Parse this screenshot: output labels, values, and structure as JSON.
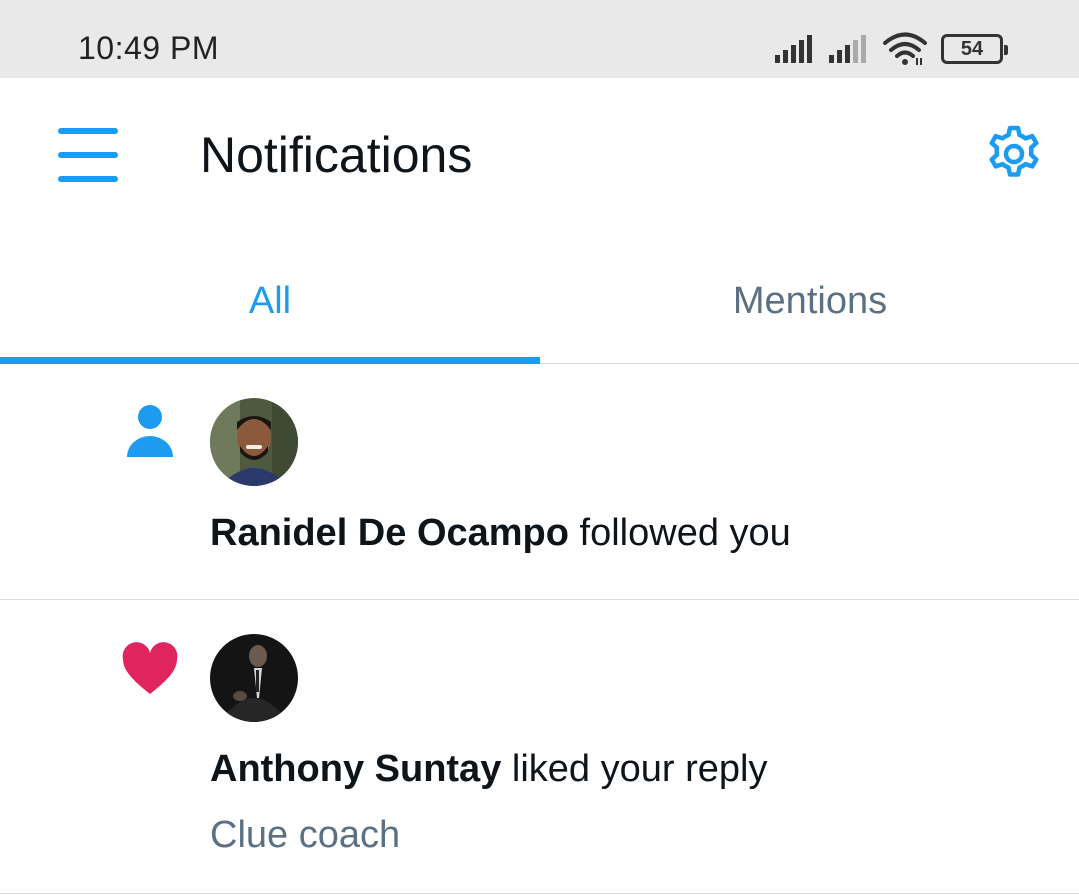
{
  "status_bar": {
    "time": "10:49 PM",
    "battery": "54",
    "icons": [
      "signal-icon",
      "signal-icon",
      "wifi-icon",
      "battery-icon"
    ]
  },
  "header": {
    "title": "Notifications",
    "menu_icon": "hamburger-menu-icon",
    "settings_icon": "gear-icon"
  },
  "tabs": [
    {
      "label": "All",
      "active": true
    },
    {
      "label": "Mentions",
      "active": false
    }
  ],
  "colors": {
    "accent": "#1d9bf0",
    "like": "#e0245e",
    "secondary_text": "#5b7083"
  },
  "notifications": [
    {
      "type_icon": "person-icon",
      "user": "Ranidel De Ocampo",
      "action": "followed you",
      "detail": ""
    },
    {
      "type_icon": "heart-icon",
      "user": "Anthony Suntay",
      "action": "liked your reply",
      "detail": "Clue coach"
    }
  ]
}
